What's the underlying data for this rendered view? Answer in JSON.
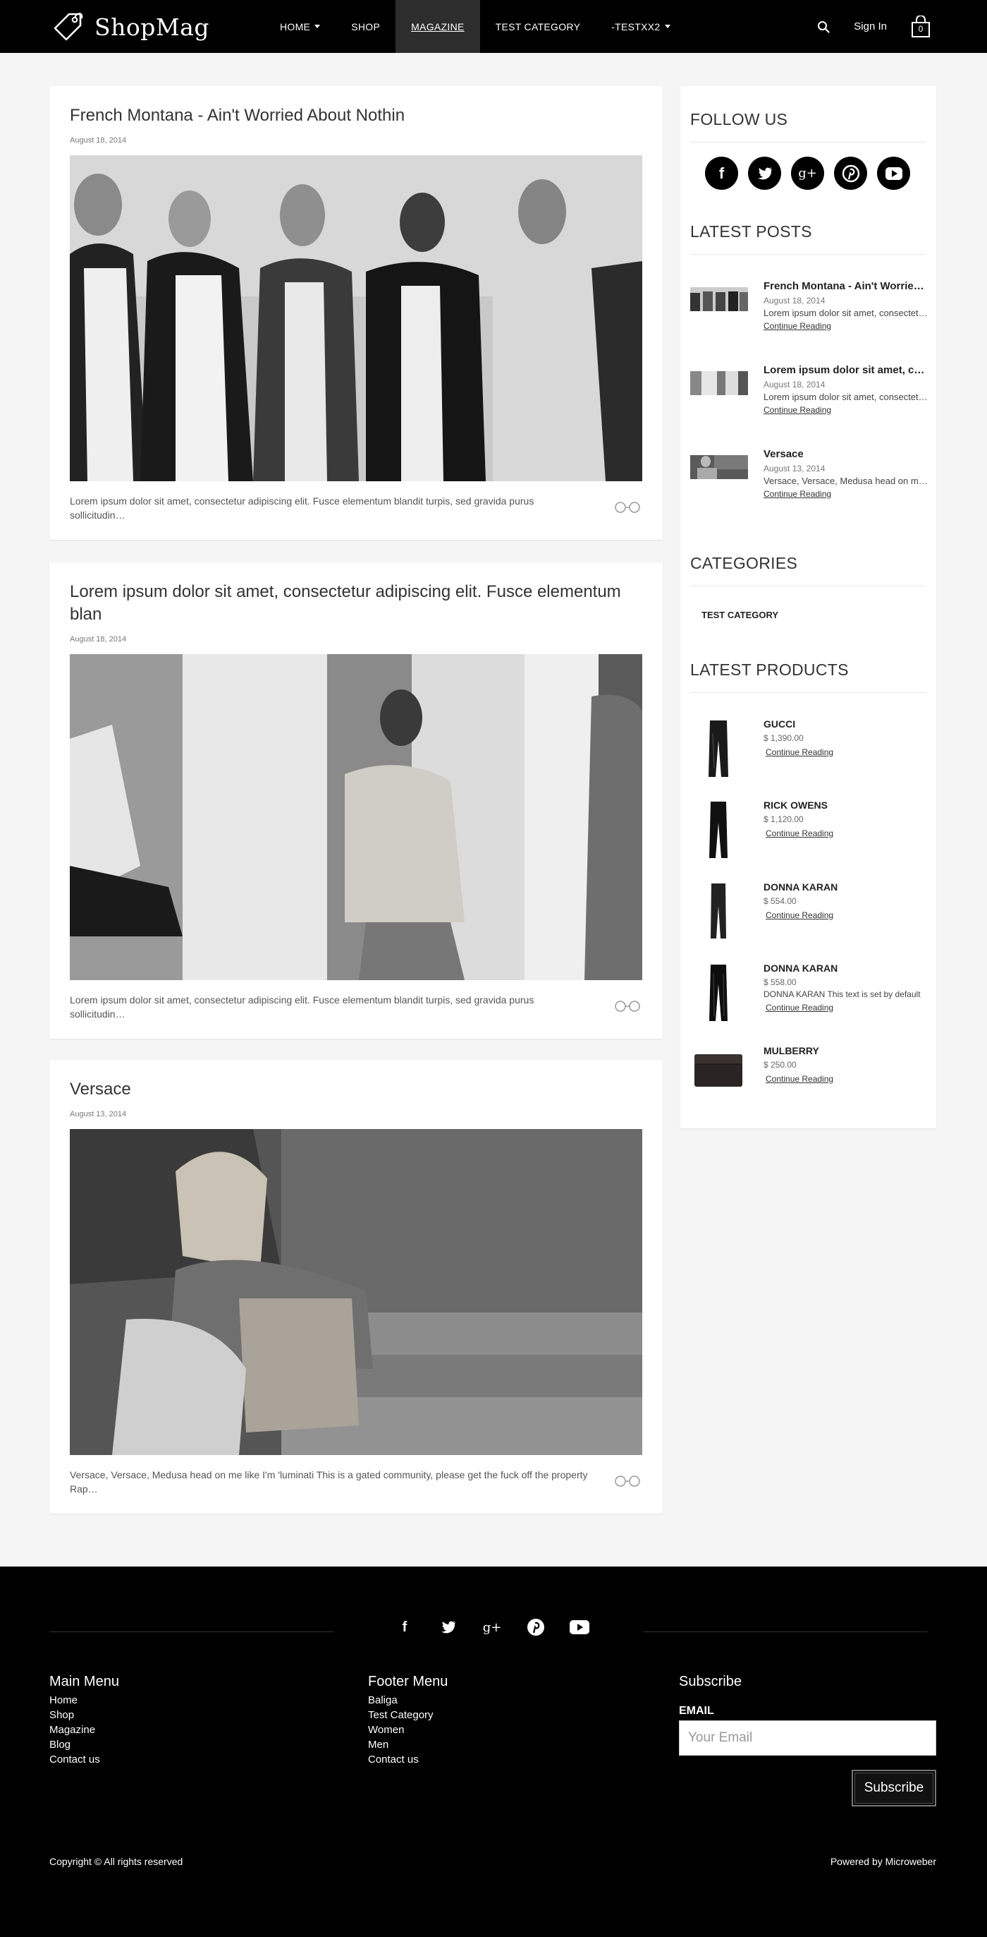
{
  "brand": {
    "name": "ShopMag",
    "logo_icon": "tag-icon"
  },
  "nav": {
    "items": [
      {
        "label": "HOME",
        "has_dropdown": true,
        "active": false
      },
      {
        "label": "SHOP",
        "has_dropdown": false,
        "active": false
      },
      {
        "label": "MAGAZINE",
        "has_dropdown": false,
        "active": true
      },
      {
        "label": "TEST CATEGORY",
        "has_dropdown": false,
        "active": false
      },
      {
        "label": "-TESTXX2",
        "has_dropdown": true,
        "active": false
      }
    ],
    "signin_label": "Sign In",
    "cart_count": "0"
  },
  "posts": [
    {
      "title": "French Montana - Ain't Worried About Nothin",
      "date": "August 18, 2014",
      "excerpt": "Lorem ipsum dolor sit amet, consectetur adipiscing elit. Fusce elementum blandit turpis, sed gravida purus sollicitudin…"
    },
    {
      "title": "Lorem ipsum dolor sit amet, consectetur adipiscing elit. Fusce elementum blan",
      "date": "August 18, 2014",
      "excerpt": "Lorem ipsum dolor sit amet, consectetur adipiscing elit. Fusce elementum blandit turpis, sed gravida purus sollicitudin…"
    },
    {
      "title": "Versace",
      "date": "August 13, 2014",
      "excerpt": "Versace, Versace, Medusa head on me like I'm 'luminati This is a gated community, please get the fuck off the property Rap…"
    }
  ],
  "sidebar": {
    "follow_heading": "FOLLOW US",
    "social_icons": [
      "facebook-icon",
      "twitter-icon",
      "google-plus-icon",
      "pinterest-icon",
      "youtube-icon"
    ],
    "latest_posts_heading": "LATEST POSTS",
    "latest_posts": [
      {
        "title": "French Montana - Ain't Worried About Nothin",
        "date": "August 18, 2014",
        "text": "Lorem ipsum dolor sit amet, consectetur adipiscing elit.",
        "link": "Continue Reading"
      },
      {
        "title": "Lorem ipsum dolor sit amet, consectetur",
        "date": "August 18, 2014",
        "text": "Lorem ipsum dolor sit amet, consectetur adipiscing elit.",
        "link": "Continue Reading"
      },
      {
        "title": "Versace",
        "date": "August 13, 2014",
        "text": "Versace, Versace, Medusa head on me like I'm 'luminati",
        "link": "Continue Reading"
      }
    ],
    "categories_heading": "CATEGORIES",
    "categories": [
      "TEST CATEGORY"
    ],
    "latest_products_heading": "LATEST PRODUCTS",
    "products": [
      {
        "name": "GUCCI",
        "price": "$ 1,390.00",
        "desc": "",
        "link": "Continue Reading"
      },
      {
        "name": "RICK OWENS",
        "price": "$ 1,120.00",
        "desc": "",
        "link": "Continue Reading"
      },
      {
        "name": "DONNA KARAN",
        "price": "$ 554.00",
        "desc": "",
        "link": "Continue Reading"
      },
      {
        "name": "DONNA KARAN",
        "price": "$ 558.00",
        "desc": "DONNA KARAN This text is set by default",
        "link": "Continue Reading"
      },
      {
        "name": "MULBERRY",
        "price": "$ 250.00",
        "desc": "",
        "link": "Continue Reading"
      }
    ]
  },
  "footer": {
    "social_icons": [
      "facebook-icon",
      "twitter-icon",
      "google-plus-icon",
      "pinterest-icon",
      "youtube-icon"
    ],
    "main_menu_title": "Main Menu",
    "main_menu": [
      "Home",
      "Shop",
      "Magazine",
      "Blog",
      "Contact us"
    ],
    "footer_menu_title": "Footer Menu",
    "footer_menu": [
      "Baliga",
      "Test Category",
      "Women",
      "Men",
      "Contact us"
    ],
    "subscribe_title": "Subscribe",
    "email_label": "EMAIL",
    "email_placeholder": "Your Email",
    "subscribe_button": "Subscribe",
    "copyright": "Copyright © All rights reserved",
    "powered_by": "Powered by Microweber"
  }
}
